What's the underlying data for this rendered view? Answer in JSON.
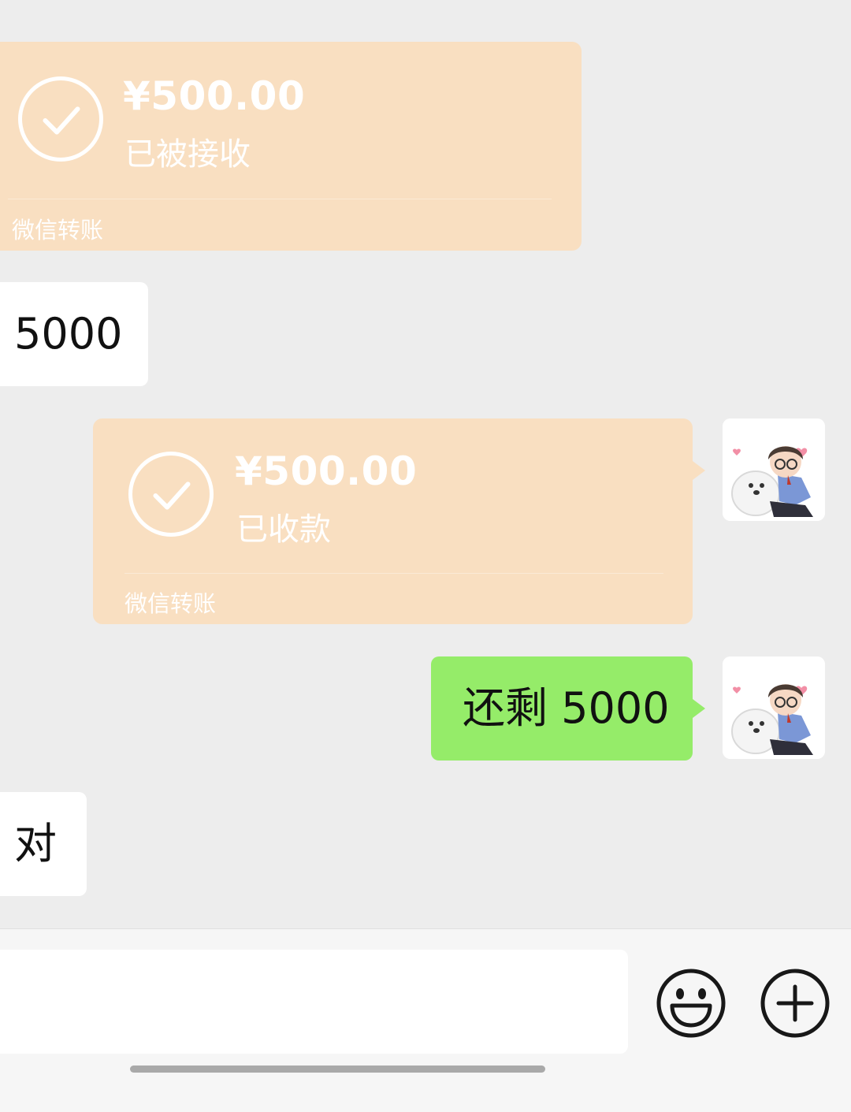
{
  "messages": [
    {
      "type": "transfer",
      "side": "left",
      "amount": "¥500.00",
      "status": "已被接收",
      "source": "微信转账"
    },
    {
      "type": "text",
      "side": "left",
      "text": "5000"
    },
    {
      "type": "transfer",
      "side": "right",
      "amount": "¥500.00",
      "status": "已收款",
      "source": "微信转账"
    },
    {
      "type": "text",
      "side": "right",
      "text": "还剩 5000"
    },
    {
      "type": "text",
      "side": "left",
      "text": "对"
    }
  ],
  "input_bar": {
    "input_value": "",
    "input_placeholder": "",
    "emoji_icon": "smiley-face-icon",
    "plus_icon": "plus-circle-icon"
  },
  "colors": {
    "chat_background": "#ededed",
    "transfer_card": "#f9dfc1",
    "sent_bubble": "#95ec69",
    "received_bubble": "#ffffff"
  }
}
